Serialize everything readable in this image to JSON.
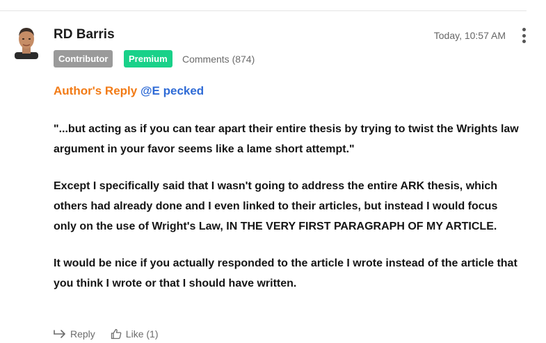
{
  "comment": {
    "author": "RD Barris",
    "timestamp": "Today, 10:57 AM",
    "badges": {
      "contributor": "Contributor",
      "premium": "Premium"
    },
    "comments_link": "Comments (874)",
    "reply_label": "Author's Reply",
    "mention": "@E pecked",
    "paragraphs": [
      "\"...but acting as if you can tear apart their entire thesis by trying to twist the Wrights law argument in your favor seems like a lame short attempt.\"",
      "Except I specifically said that I wasn't going to address the entire ARK thesis, which others had already done and I even linked to their articles, but instead I would focus only on the use of Wright's Law, IN THE VERY FIRST PARAGRAPH OF MY ARTICLE.",
      "It would be nice if you actually responded to the article I wrote instead of the article that you think I wrote or that I should have written."
    ],
    "actions": {
      "reply": "Reply",
      "like": "Like (1)"
    }
  },
  "icons": {
    "avatar": "author-avatar",
    "more": "more-vertical-icon",
    "reply": "reply-arrow-icon",
    "like": "thumbs-up-icon"
  },
  "colors": {
    "accent_orange": "#f27b16",
    "mention_blue": "#2f6bd6",
    "badge_gray": "#9a9a9a",
    "badge_green": "#19d189"
  }
}
